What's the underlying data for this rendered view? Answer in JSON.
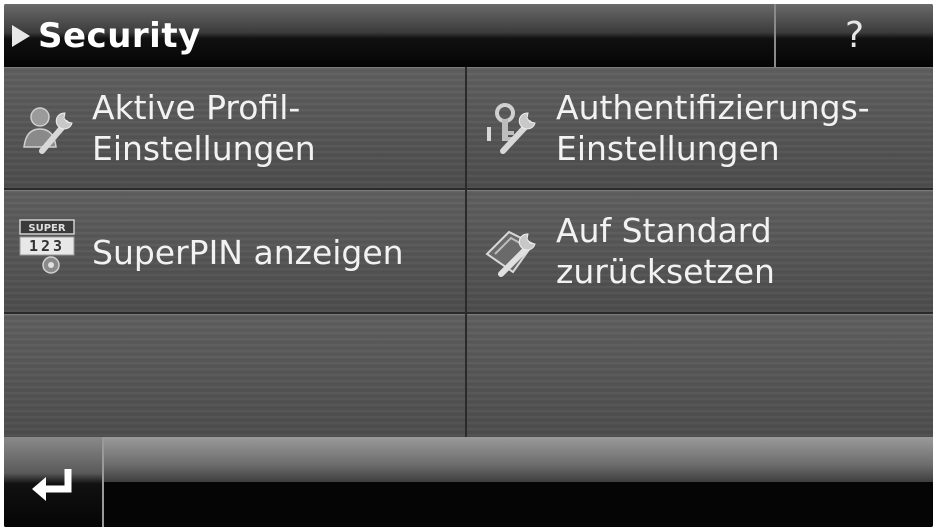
{
  "header": {
    "title": "Security",
    "help_label": "?"
  },
  "menu": {
    "items": [
      {
        "line1": "Aktive Profil-",
        "line2": "Einstellungen",
        "icon": "profile-wrench-icon"
      },
      {
        "line1": "Authentifizierungs-",
        "line2": "Einstellungen",
        "icon": "key-wrench-icon"
      },
      {
        "line1": "SuperPIN anzeigen",
        "icon": "superpin-icon",
        "icon_text_top": "SUPER",
        "icon_text_digits": "123"
      },
      {
        "line1": "Auf Standard",
        "line2": "zurücksetzen",
        "icon": "reset-wrench-icon"
      }
    ]
  },
  "footer": {
    "back_icon": "enter-back-icon"
  }
}
